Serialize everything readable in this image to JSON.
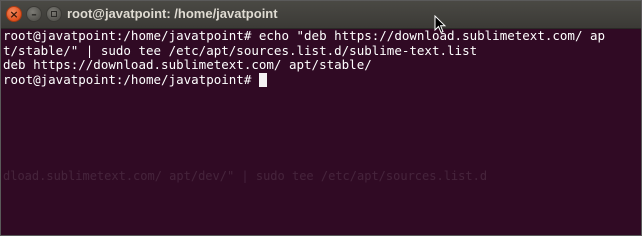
{
  "window": {
    "title": "root@javatpoint: /home/javatpoint",
    "buttons": {
      "close_icon": "close-icon",
      "close_glyph": "×",
      "minimize_icon": "minimize-icon",
      "minimize_glyph": "–",
      "maximize_icon": "maximize-icon"
    }
  },
  "terminal": {
    "lines": [
      "root@javatpoint:/home/javatpoint# echo \"deb https://download.sublimetext.com/ ap",
      "t/stable/\" | sudo tee /etc/apt/sources.list.d/sublime-text.list",
      "deb https://download.sublimetext.com/ apt/stable/",
      "root@javatpoint:/home/javatpoint# "
    ],
    "ghost_text": {
      "line1": "dload.sublimetext.com/ apt/dev/\" | sudo tee /etc/apt/sources.list.d"
    }
  },
  "colors": {
    "terminal_bg": "#300a24",
    "text": "#ffffff",
    "titlebar": "#3c3b37",
    "close_button": "#e0511f"
  }
}
